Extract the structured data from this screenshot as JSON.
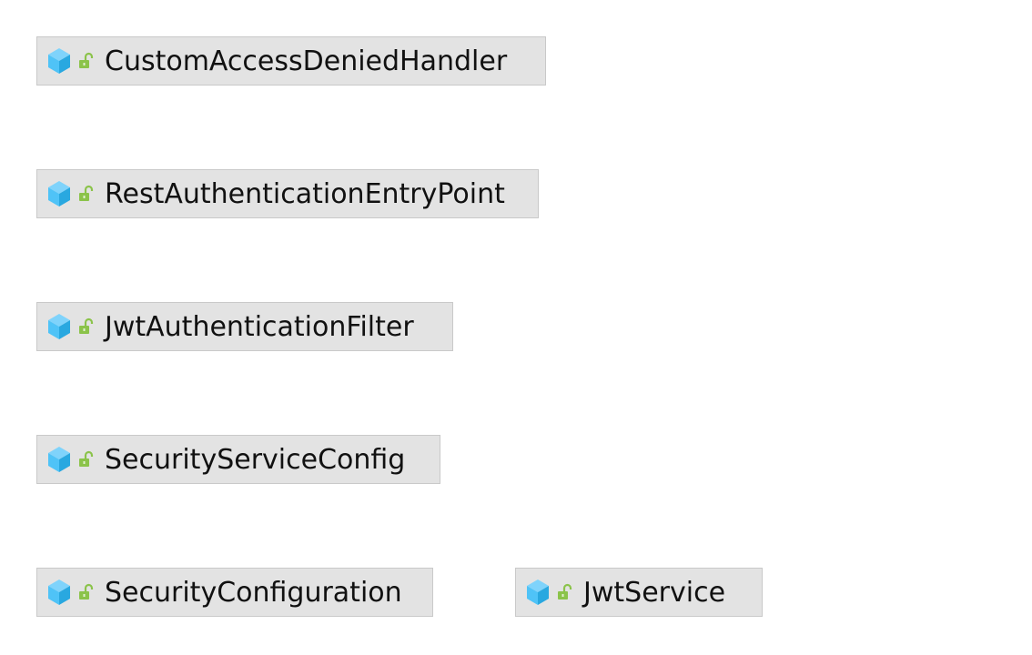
{
  "colors": {
    "node_fill": "#e3e3e3",
    "node_border": "#c9c9c9",
    "class_icon": "#4fc3f7",
    "lock_icon": "#8bc34a"
  },
  "icons": {
    "class": "class-cube-icon",
    "visibility": "unlocked-padlock-icon"
  },
  "classes": [
    {
      "name": "CustomAccessDeniedHandler"
    },
    {
      "name": "RestAuthenticationEntryPoint"
    },
    {
      "name": "JwtAuthenticationFilter"
    },
    {
      "name": "SecurityServiceConfig"
    },
    {
      "name": "SecurityConfiguration"
    },
    {
      "name": "JwtService"
    }
  ]
}
